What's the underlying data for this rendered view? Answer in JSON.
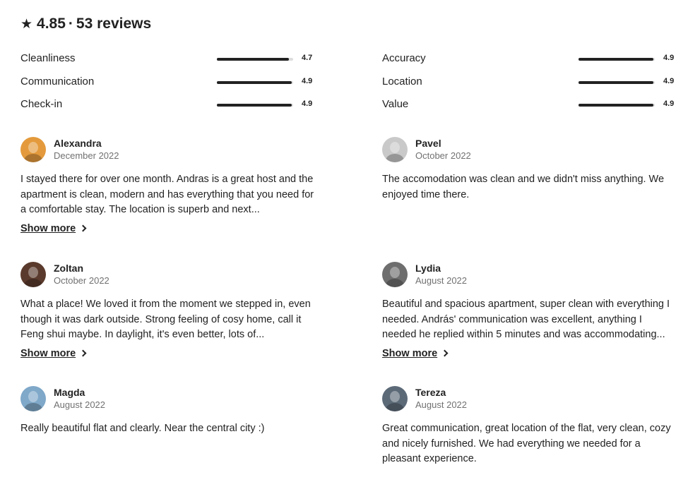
{
  "summary": {
    "star_icon": "star-icon",
    "rating": "4.85",
    "separator": "·",
    "review_count": "53 reviews"
  },
  "categories_left": [
    {
      "label": "Cleanliness",
      "score": "4.7",
      "value": 4.7
    },
    {
      "label": "Communication",
      "score": "4.9",
      "value": 4.9
    },
    {
      "label": "Check-in",
      "score": "4.9",
      "value": 4.9
    }
  ],
  "categories_right": [
    {
      "label": "Accuracy",
      "score": "4.9",
      "value": 4.9
    },
    {
      "label": "Location",
      "score": "4.9",
      "value": 4.9
    },
    {
      "label": "Value",
      "score": "4.9",
      "value": 4.9
    }
  ],
  "rating_max": 5,
  "show_more_label": "Show more",
  "reviews": [
    {
      "name": "Alexandra",
      "date": "December 2022",
      "text": "I stayed there for over one month. Andras is a great host and the apartment is clean, modern and has everything that you need for a comfortable stay. The location is superb and next...",
      "has_show_more": true,
      "avatar_color": "#e49a3c"
    },
    {
      "name": "Pavel",
      "date": "October 2022",
      "text": "The accomodation was clean and we didn't miss anything. We enjoyed time there.",
      "has_show_more": false,
      "avatar_color": "#c9c9c9"
    },
    {
      "name": "Zoltan",
      "date": "October 2022",
      "text": "What a place! We loved it from the moment we stepped in, even though it was dark outside. Strong feeling of cosy home, call it Feng shui maybe. In daylight, it's even better, lots of...",
      "has_show_more": true,
      "avatar_color": "#5a3a2c"
    },
    {
      "name": "Lydia",
      "date": "August 2022",
      "text": "Beautiful and spacious apartment, super clean with everything I needed. András' communication was excellent, anything I needed he replied within 5 minutes and was accommodating...",
      "has_show_more": true,
      "avatar_color": "#6e6e6e"
    },
    {
      "name": "Magda",
      "date": "August 2022",
      "text": "Really beautiful flat and clearly. Near the central city :)",
      "has_show_more": false,
      "avatar_color": "#7fa8c9"
    },
    {
      "name": "Tereza",
      "date": "August 2022",
      "text": "Great communication, great location of the flat, very clean, cozy and nicely furnished. We had everything we needed for a pleasant experience.",
      "has_show_more": false,
      "avatar_color": "#5c6a78"
    }
  ]
}
